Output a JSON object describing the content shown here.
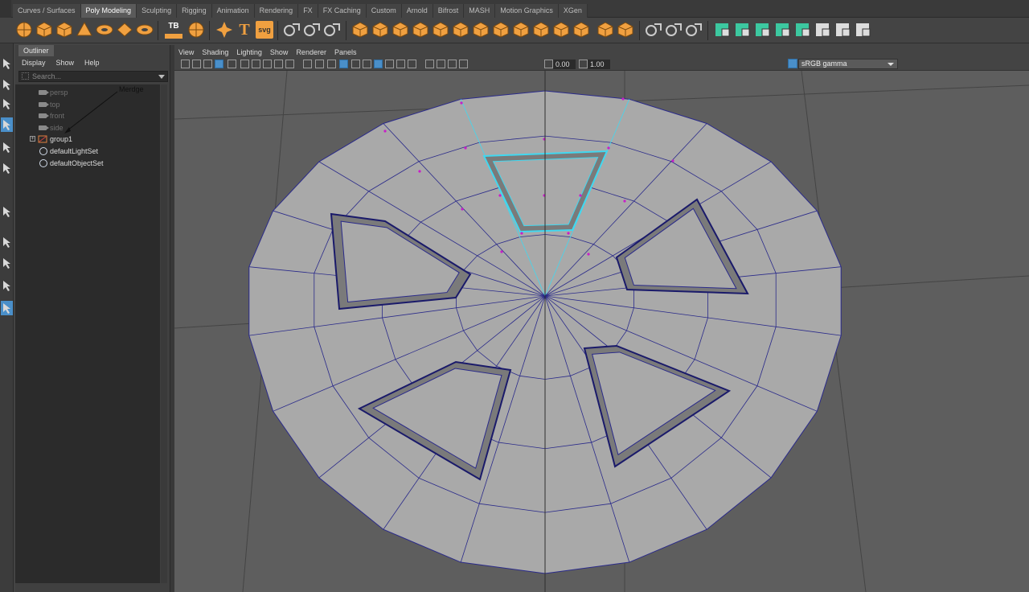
{
  "shelf": {
    "tabs": [
      "Curves / Surfaces",
      "Poly Modeling",
      "Sculpting",
      "Rigging",
      "Animation",
      "Rendering",
      "FX",
      "FX Caching",
      "Custom",
      "Arnold",
      "Bifrost",
      "MASH",
      "Motion Graphics",
      "XGen"
    ],
    "active_tab": "Poly Modeling",
    "icon_labels": {
      "type_tool": "T",
      "svg_tool": "svg",
      "tb_tool": "TB"
    },
    "accent_color": "#f0a040",
    "teal_color": "#3cc8a0"
  },
  "outliner": {
    "title": "Outliner",
    "menu": [
      "Display",
      "Show",
      "Help"
    ],
    "search_placeholder": "Search...",
    "items": [
      {
        "label": "persp",
        "icon": "camera-icon",
        "dim": true
      },
      {
        "label": "top",
        "icon": "camera-icon",
        "dim": true
      },
      {
        "label": "front",
        "icon": "camera-icon",
        "dim": true
      },
      {
        "label": "side",
        "icon": "camera-icon",
        "dim": true
      },
      {
        "label": "group1",
        "icon": "group-icon",
        "dim": false,
        "expander": "+"
      },
      {
        "label": "defaultLightSet",
        "icon": "set-icon",
        "dim": false
      },
      {
        "label": "defaultObjectSet",
        "icon": "set-icon",
        "dim": false
      }
    ],
    "annotation": "Merdge"
  },
  "panel": {
    "menu": [
      "View",
      "Shading",
      "Lighting",
      "Show",
      "Renderer",
      "Panels"
    ],
    "exposure": "0.00",
    "gamma": "1.00",
    "color_space": "sRGB gamma"
  },
  "viewport": {
    "background_color": "#5e5e5e",
    "mesh_fill": "#a9a9a9",
    "wire_color": "#2a2a8a",
    "selected_edge_color": "#40d8f0",
    "vertex_color": "#c81ec8"
  }
}
